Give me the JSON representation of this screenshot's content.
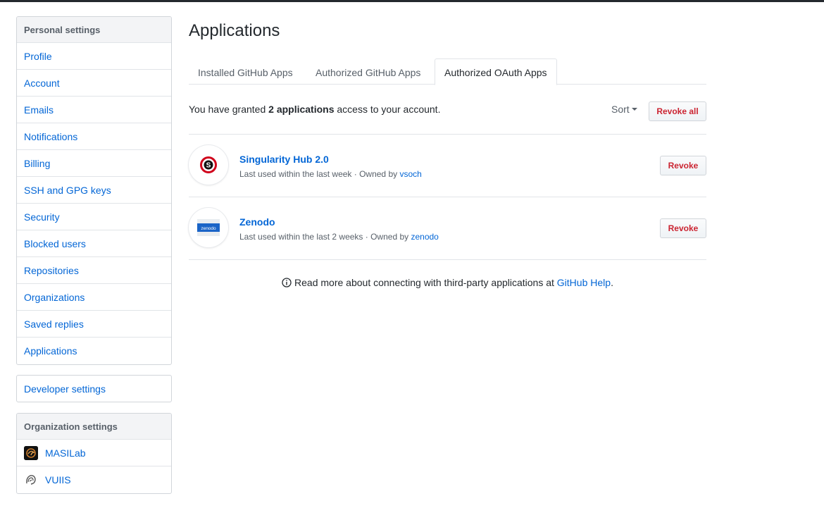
{
  "sidebar": {
    "personal_heading": "Personal settings",
    "items": [
      {
        "label": "Profile"
      },
      {
        "label": "Account"
      },
      {
        "label": "Emails"
      },
      {
        "label": "Notifications"
      },
      {
        "label": "Billing"
      },
      {
        "label": "SSH and GPG keys"
      },
      {
        "label": "Security"
      },
      {
        "label": "Blocked users"
      },
      {
        "label": "Repositories"
      },
      {
        "label": "Organizations"
      },
      {
        "label": "Saved replies"
      },
      {
        "label": "Applications"
      }
    ],
    "developer_settings": "Developer settings",
    "org_heading": "Organization settings",
    "orgs": [
      {
        "label": "MASILab",
        "icon": "masilab-avatar-icon"
      },
      {
        "label": "VUIIS",
        "icon": "vuiis-avatar-icon"
      }
    ]
  },
  "main": {
    "title": "Applications",
    "tabs": [
      {
        "label": "Installed GitHub Apps"
      },
      {
        "label": "Authorized GitHub Apps"
      },
      {
        "label": "Authorized OAuth Apps",
        "active": true
      }
    ],
    "summary": {
      "prefix": "You have granted",
      "count": "2 applications",
      "suffix": "access to your account."
    },
    "sort_label": "Sort",
    "revoke_all_label": "Revoke all",
    "apps": [
      {
        "name": "Singularity Hub 2.0",
        "last_used": "Last used within the last week · Owned by",
        "owner": "vsoch",
        "revoke_label": "Revoke"
      },
      {
        "name": "Zenodo",
        "last_used": "Last used within the last 2 weeks · Owned by",
        "owner": "zenodo",
        "revoke_label": "Revoke",
        "logo_text": "zenodo"
      }
    ],
    "help": {
      "text": "Read more about connecting with third-party applications at",
      "link": "GitHub Help",
      "suffix": "."
    }
  },
  "colors": {
    "link": "#0366d6",
    "danger": "#cb2431",
    "topbar": "#24292e"
  }
}
